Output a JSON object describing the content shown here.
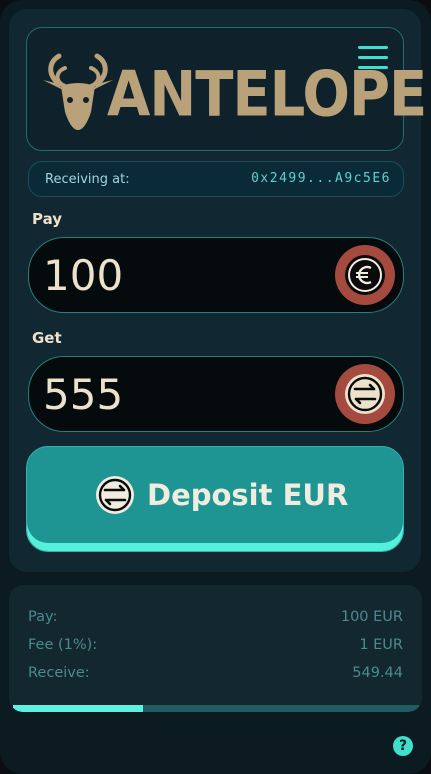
{
  "brand": {
    "name": "ANTELOPE",
    "logo_icon": "antelope-head-icon",
    "color": "#b9a27a"
  },
  "header": {
    "menu_icon": "hamburger-menu-icon"
  },
  "receiving": {
    "label": "Receiving at:",
    "address": "0x2499...A9c5E6"
  },
  "pay": {
    "label": "Pay",
    "value": "100",
    "currency_icon": "euro-coin-icon"
  },
  "get": {
    "label": "Get",
    "value": "555",
    "currency_icon": "exchange-coin-icon"
  },
  "deposit_button": {
    "label": "Deposit EUR",
    "icon": "exchange-icon"
  },
  "summary": {
    "rows": [
      {
        "key": "Pay:",
        "value": "100 EUR"
      },
      {
        "key": "Fee (1%):",
        "value": "1 EUR"
      },
      {
        "key": "Receive:",
        "value": "549.44"
      }
    ],
    "progress": 0.32
  },
  "help": {
    "label": "?",
    "icon": "help-icon"
  },
  "colors": {
    "accent": "#3ee0cc",
    "button": "#1f9593",
    "coin": "#a44a3e",
    "cream": "#ece2cc"
  }
}
